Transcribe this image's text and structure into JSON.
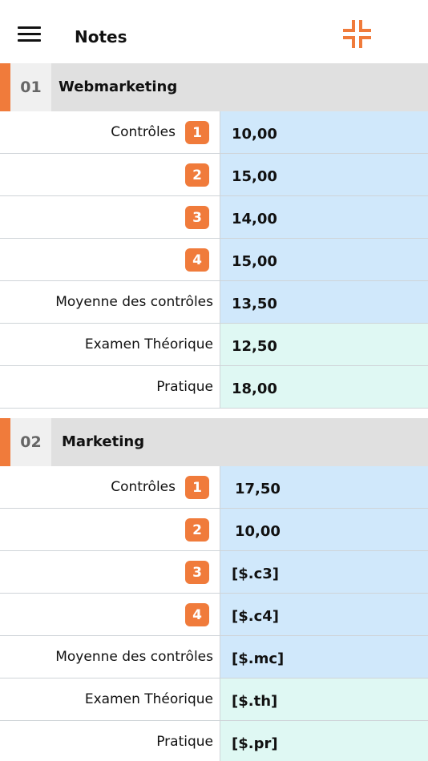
{
  "app": {
    "title": "Notes"
  },
  "sections": [
    {
      "number": "01",
      "title": "Webmarketing",
      "rows": [
        {
          "label": "Contrôles",
          "badge": "1",
          "value": "10,00"
        },
        {
          "label": "",
          "badge": "2",
          "value": "15,00"
        },
        {
          "label": "",
          "badge": "3",
          "value": "14,00"
        },
        {
          "label": "",
          "badge": "4",
          "value": "15,00"
        },
        {
          "label": "Moyenne des contrôles",
          "value": "13,50"
        },
        {
          "label": "Examen Théorique",
          "value": "12,50"
        },
        {
          "label": "Pratique",
          "value": "18,00"
        }
      ]
    },
    {
      "number": "02",
      "title": "Marketing",
      "rows": [
        {
          "label": "Contrôles",
          "badge": "1",
          "value": "17,50"
        },
        {
          "label": "",
          "badge": "2",
          "value": "10,00"
        },
        {
          "label": "",
          "badge": "3",
          "value": "[$.c3]"
        },
        {
          "label": "",
          "badge": "4",
          "value": "[$.c4]"
        },
        {
          "label": "Moyenne des contrôles",
          "value": "[$.mc]"
        },
        {
          "label": "Examen Théorique",
          "value": "[$.th]"
        },
        {
          "label": "Pratique",
          "value": "[$.pr]"
        }
      ]
    }
  ],
  "colors": {
    "accent": "#f07b3b",
    "controls_cell": "#d0e8fb",
    "exam_cell": "#dff8f3",
    "section_header": "#e0e0e0"
  },
  "icons": {
    "menu": "hamburger-menu-icon",
    "collapse": "collapse-arrows-icon"
  }
}
